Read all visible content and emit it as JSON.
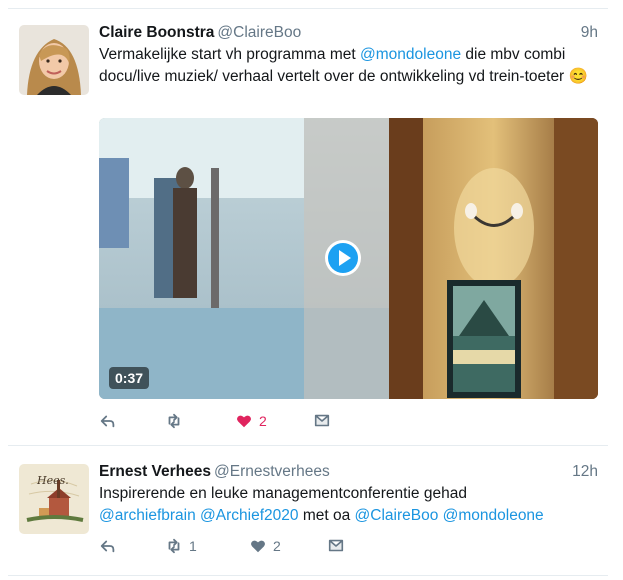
{
  "tweets": [
    {
      "display_name": "Claire Boonstra",
      "handle": "@ClaireBoo",
      "time": "9h",
      "text_parts": [
        "Vermakelijke start vh programma met ",
        "@mondoleone",
        " die mbv combi docu/live muziek/ verhaal vertelt over de ontwikkeling vd trein-toeter "
      ],
      "emoji": "😊",
      "video": {
        "duration": "0:37"
      },
      "actions": {
        "reply_count": "",
        "retweet_count": "",
        "like_count": "2",
        "liked": true
      }
    },
    {
      "display_name": "Ernest Verhees",
      "handle": "@Ernestverhees",
      "time": "12h",
      "avatar_caption": "Hees.",
      "text_line1": "Inspirerende en leuke managementconferentie gehad",
      "text_parts2": [
        "@archiefbrain",
        " ",
        "@Archief2020",
        " met oa ",
        "@ClaireBoo",
        " ",
        "@mondoleone"
      ],
      "actions": {
        "reply_count": "",
        "retweet_count": "1",
        "like_count": "2",
        "liked": false
      }
    }
  ],
  "colors": {
    "link": "#1b95e0",
    "meta": "#657786",
    "like_active": "#e0245e",
    "divider": "#e6ecf0"
  },
  "icons": [
    "reply-icon",
    "retweet-icon",
    "heart-icon",
    "message-icon",
    "play-icon"
  ]
}
